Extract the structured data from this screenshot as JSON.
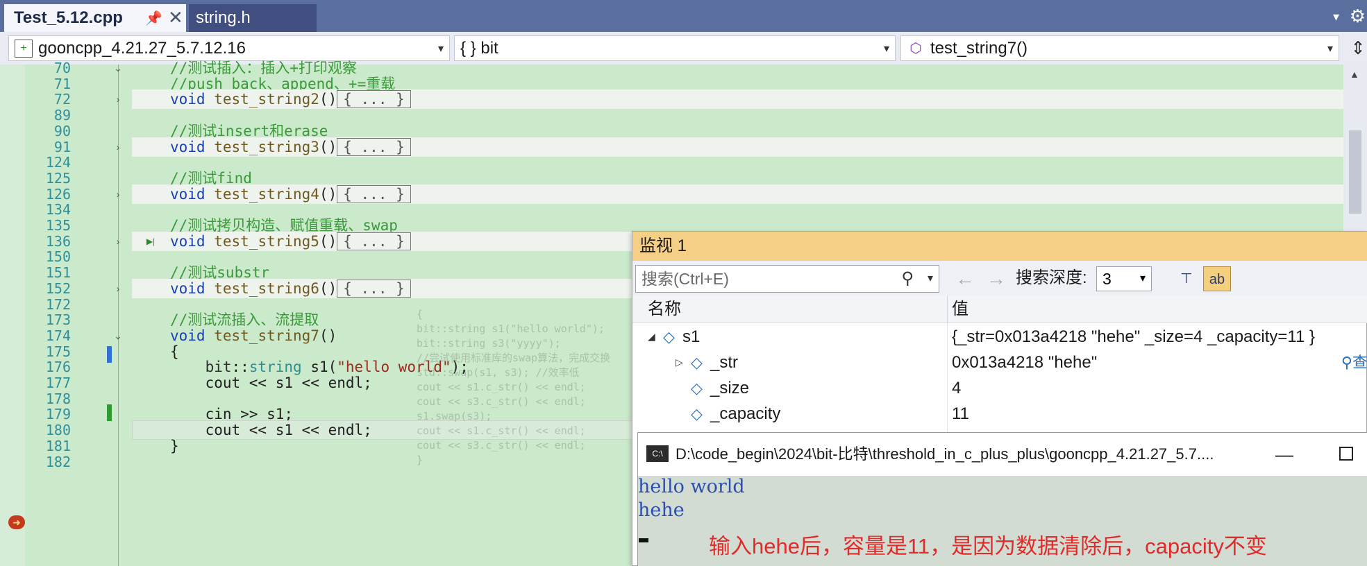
{
  "tabs": [
    {
      "label": "Test_5.12.cpp",
      "active": true
    },
    {
      "label": "string.h",
      "active": false
    }
  ],
  "icons": {
    "pin": "📌",
    "close": "✕",
    "drop": "▾",
    "gear": "⚙",
    "caret": "▾",
    "split": "⇕",
    "fold_open": "⌄",
    "fold_closed": "›",
    "run": "▶|",
    "bp": "➜",
    "scroll_up": "▲",
    "mag": "⚲",
    "dd": "▾",
    "back": "←",
    "fwd": "→",
    "pin_tool": "⊤",
    "ab_tool": "ab",
    "expanded": "◢",
    "collapsed": "▷",
    "var": "◇",
    "field": "◇",
    "viewer": "⚲查",
    "console": "C:\\",
    "minimize": "—"
  },
  "navbar": {
    "project": "gooncpp_4.21.27_5.7.12.16",
    "scope": "{ } bit",
    "function": "test_string7()"
  },
  "editor": {
    "lines": [
      {
        "n": "70",
        "fold": "open",
        "code": "//测试插入：插入+打印观察",
        "kind": "comment"
      },
      {
        "n": "71",
        "fold": "",
        "code": "//push_back、append、+=重载",
        "kind": "comment"
      },
      {
        "n": "72",
        "fold": "closed",
        "kw": "void",
        "fn": "test_string2",
        "box": "{ ... }",
        "kind": "collapsed"
      },
      {
        "n": "89",
        "fold": "",
        "code": "",
        "kind": "blank"
      },
      {
        "n": "90",
        "fold": "",
        "code": "//测试insert和erase",
        "kind": "comment"
      },
      {
        "n": "91",
        "fold": "closed",
        "kw": "void",
        "fn": "test_string3",
        "box": "{ ... }",
        "kind": "collapsed"
      },
      {
        "n": "124",
        "fold": "",
        "code": "",
        "kind": "blank"
      },
      {
        "n": "125",
        "fold": "",
        "code": "//测试find",
        "kind": "comment"
      },
      {
        "n": "126",
        "fold": "closed",
        "kw": "void",
        "fn": "test_string4",
        "box": "{ ... }",
        "kind": "collapsed"
      },
      {
        "n": "134",
        "fold": "",
        "code": "",
        "kind": "blank"
      },
      {
        "n": "135",
        "fold": "",
        "code": "//测试拷贝构造、赋值重载、swap",
        "kind": "comment"
      },
      {
        "n": "136",
        "fold": "closed",
        "kw": "void",
        "fn": "test_string5",
        "box": "{ ... }",
        "kind": "collapsed"
      },
      {
        "n": "150",
        "fold": "",
        "code": "",
        "kind": "blank"
      },
      {
        "n": "151",
        "fold": "",
        "code": "//测试substr",
        "kind": "comment"
      },
      {
        "n": "152",
        "fold": "closed",
        "kw": "void",
        "fn": "test_string6",
        "box": "{ ... }",
        "kind": "collapsed"
      },
      {
        "n": "172",
        "fold": "",
        "code": "",
        "kind": "blank"
      },
      {
        "n": "173",
        "fold": "",
        "code": "//测试流插入、流提取",
        "kind": "comment"
      },
      {
        "n": "174",
        "fold": "open",
        "kw": "void",
        "fn": "test_string7",
        "kind": "decl"
      },
      {
        "n": "175",
        "fold": "",
        "code": "{",
        "kind": "plain"
      },
      {
        "n": "176",
        "fold": "",
        "kind": "l176"
      },
      {
        "n": "177",
        "fold": "",
        "kind": "l177"
      },
      {
        "n": "178",
        "fold": "",
        "code": "",
        "kind": "blank"
      },
      {
        "n": "179",
        "fold": "",
        "kind": "l179"
      },
      {
        "n": "180",
        "fold": "",
        "kind": "l180"
      },
      {
        "n": "181",
        "fold": "",
        "code": "}",
        "kind": "plain"
      },
      {
        "n": "182",
        "fold": "",
        "code": "",
        "kind": "blank"
      }
    ],
    "l176": {
      "ns": "bit",
      "sep": "::",
      "type": "string",
      "var": " s1(",
      "str": "\"hello world\"",
      "end": ");",
      "indent": "    "
    },
    "l177": {
      "text": "    cout << s1 << endl;"
    },
    "l179": {
      "text": "    cin >> s1;"
    },
    "l180": {
      "text": "    cout << s1 << endl;"
    }
  },
  "ghost": [
    "{",
    "  bit::string s1(\"hello world\");",
    "  bit::string s3(\"yyyy\");",
    "",
    "  //尝试使用标准库的swap算法，完成交换",
    "  std::swap(s1, s3);          //效率低",
    "  cout << s1.c_str() << endl;",
    "  cout << s3.c_str() << endl;",
    "",
    "  s1.swap(s3);",
    "  cout << s1.c_str() << endl;",
    "  cout << s3.c_str() << endl;",
    "}"
  ],
  "watch": {
    "title": "监视 1",
    "search_placeholder": "搜索(Ctrl+E)",
    "depth_label": "搜索深度:",
    "depth_value": "3",
    "col_name": "名称",
    "col_value": "值",
    "rows": [
      {
        "name": "s1",
        "value": "{_str=0x013a4218 \"hehe\" _size=4 _capacity=11 }",
        "level": 0,
        "expanded": true
      },
      {
        "name": "_str",
        "value": "0x013a4218 \"hehe\"",
        "level": 1,
        "expanded": false
      },
      {
        "name": "_size",
        "value": "4",
        "level": 1,
        "expanded": null
      },
      {
        "name": "_capacity",
        "value": "11",
        "level": 1,
        "expanded": null
      }
    ]
  },
  "console": {
    "title": "D:\\code_begin\\2024\\bit-比特\\threshold_in_c_plus_plus\\gooncpp_4.21.27_5.7....",
    "output": [
      "hello world",
      "hehe"
    ],
    "annotation": "输入hehe后，容量是11，是因为数据清除后，capacity不变"
  },
  "colors": {
    "tab_bar": "#5a6f9e",
    "editor_bg": "#cbe9cb",
    "watch_title": "#f5cf85",
    "annotation": "#e02b2b"
  }
}
